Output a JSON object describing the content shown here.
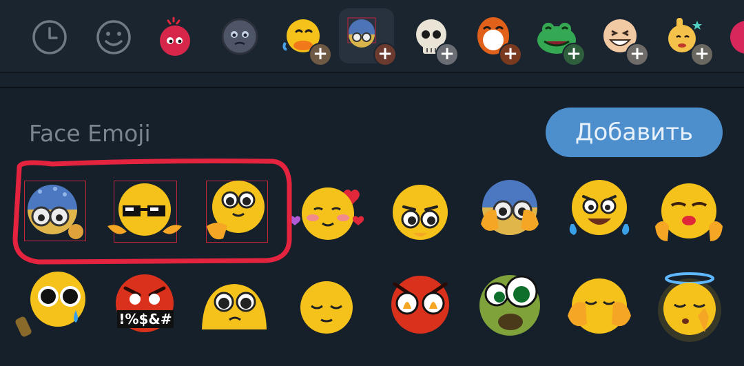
{
  "section": {
    "title": "Face Emoji",
    "add_button_label": "Добавить"
  },
  "tabs": [
    {
      "icon": "clock-icon"
    },
    {
      "icon": "smiley-icon"
    },
    {
      "icon": "red-ball-emoji"
    },
    {
      "icon": "moon-face-emoji"
    },
    {
      "icon": "duck-emoji-pack"
    },
    {
      "icon": "face-emoji-pack",
      "selected": true
    },
    {
      "icon": "skull-emoji-pack"
    },
    {
      "icon": "red-laugh-emoji-pack"
    },
    {
      "icon": "frog-emoji-pack"
    },
    {
      "icon": "grin-emoji-pack"
    },
    {
      "icon": "thumbs-up-emoji-pack"
    }
  ],
  "stickers": {
    "cursing_text": "!%$&#"
  },
  "colors": {
    "accent": "#4d8fcd",
    "highlight": "#e4243f",
    "background": "#16202b"
  }
}
